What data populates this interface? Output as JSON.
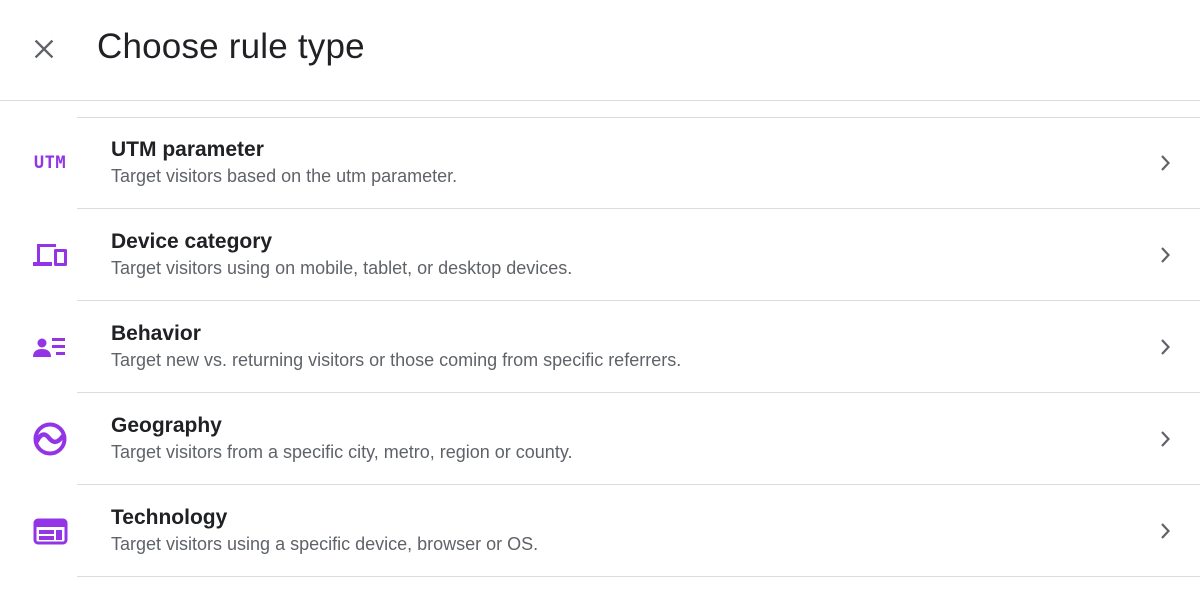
{
  "header": {
    "title": "Choose rule type",
    "close_icon": "close-icon"
  },
  "colors": {
    "accent": "#9334e6",
    "text_primary": "#202124",
    "text_secondary": "#5f6368",
    "divider": "#dadce0",
    "chevron": "#5f6368"
  },
  "rules": [
    {
      "icon_name": "utm-icon",
      "icon_text": "UTM",
      "label": "UTM parameter",
      "description": "Target visitors based on the utm parameter."
    },
    {
      "icon_name": "devices-icon",
      "label": "Device category",
      "description": "Target visitors using on mobile, tablet, or desktop devices."
    },
    {
      "icon_name": "person-list-icon",
      "label": "Behavior",
      "description": "Target new vs. returning visitors or those coming from specific referrers."
    },
    {
      "icon_name": "globe-icon",
      "label": "Geography",
      "description": "Target visitors from a specific city, metro, region or county."
    },
    {
      "icon_name": "web-window-icon",
      "label": "Technology",
      "description": "Target visitors using a specific device, browser or OS."
    }
  ]
}
